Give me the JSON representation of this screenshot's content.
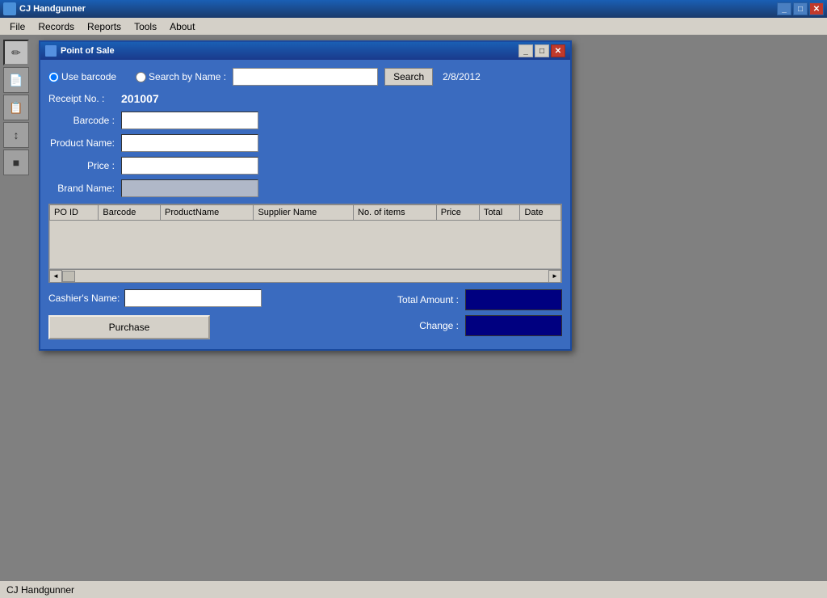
{
  "app": {
    "title": "CJ Handgunner",
    "status_bar_text": "CJ Handgunner"
  },
  "menu": {
    "items": [
      "File",
      "Records",
      "Reports",
      "Tools",
      "About"
    ]
  },
  "pos_window": {
    "title": "Point of Sale",
    "minimize_label": "_",
    "maximize_label": "□",
    "close_label": "✕"
  },
  "search": {
    "use_barcode_label": "Use barcode",
    "search_by_name_label": "Search by Name :",
    "search_button_label": "Search",
    "date": "2/8/2012",
    "name_input_value": ""
  },
  "receipt": {
    "label": "Receipt No. :",
    "number": "201007"
  },
  "form": {
    "barcode_label": "Barcode :",
    "barcode_value": "",
    "product_name_label": "Product Name:",
    "product_name_value": "",
    "price_label": "Price :",
    "price_value": "",
    "brand_name_label": "Brand Name:",
    "brand_name_value": ""
  },
  "table": {
    "columns": [
      "PO ID",
      "Barcode",
      "ProductName",
      "Supplier Name",
      "No. of items",
      "Price",
      "Total",
      "Date"
    ],
    "rows": []
  },
  "bottom": {
    "cashier_label": "Cashier's Name:",
    "cashier_value": "",
    "purchase_button": "Purchase",
    "total_amount_label": "Total Amount :",
    "total_amount_value": "",
    "change_label": "Change :",
    "change_value": ""
  },
  "sidebar": {
    "icons": [
      "✏️",
      "📄",
      "📋",
      "↕",
      "📦"
    ]
  }
}
